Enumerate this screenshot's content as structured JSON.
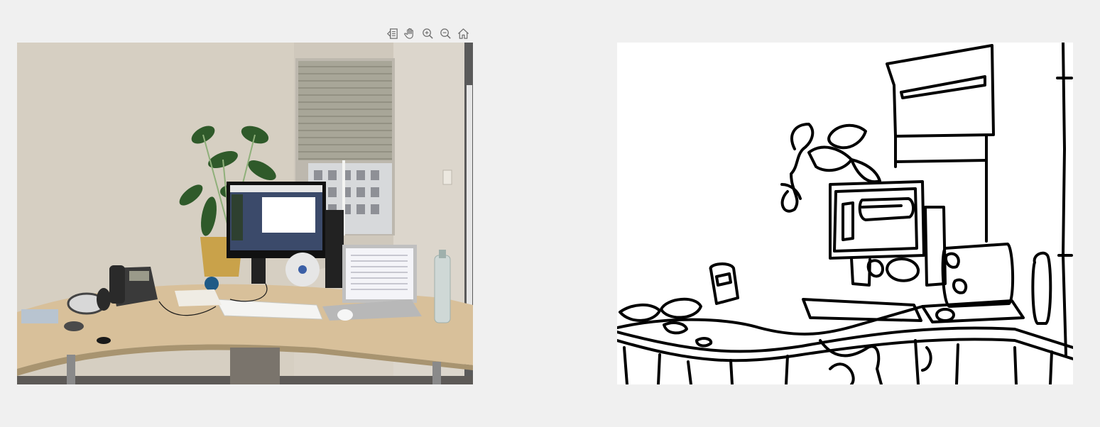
{
  "toolbar": {
    "buttons": [
      {
        "name": "brush-data-icon",
        "tooltip": ""
      },
      {
        "name": "pan-hand-icon",
        "tooltip": ""
      },
      {
        "name": "zoom-in-icon",
        "tooltip": ""
      },
      {
        "name": "zoom-out-icon",
        "tooltip": ""
      },
      {
        "name": "home-restore-view-icon",
        "tooltip": ""
      }
    ]
  },
  "colors": {
    "background": "#f0f0f0",
    "icon": "#6e6e6e",
    "wall": "#d9d2c6",
    "desk": "#d8c09a",
    "edge_lines": "#000000",
    "edge_background": "#ffffff"
  },
  "images": {
    "left": "office-photo",
    "right": "edge-map"
  }
}
